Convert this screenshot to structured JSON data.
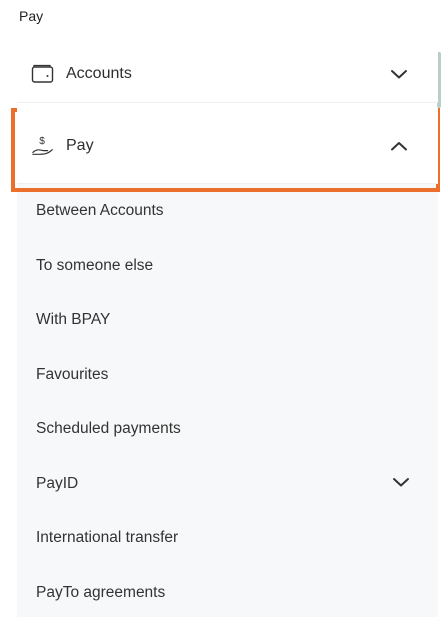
{
  "page_label": "Pay",
  "nav": {
    "accounts": {
      "label": "Accounts",
      "icon": "wallet-icon",
      "expanded": false
    },
    "pay": {
      "label": "Pay",
      "icon": "hand-dollar-icon",
      "expanded": true
    },
    "pay_items": [
      {
        "label": "Between Accounts"
      },
      {
        "label": "To someone else"
      },
      {
        "label": "With BPAY"
      },
      {
        "label": "Favourites"
      },
      {
        "label": "Scheduled payments"
      },
      {
        "label": "PayID",
        "has_children": true
      },
      {
        "label": "International transfer"
      },
      {
        "label": "PayTo agreements"
      }
    ]
  },
  "colors": {
    "highlight": "#ec6f2c",
    "submenu_bg": "#f7f8f9",
    "scroll_indicator": "#b8cfc8"
  }
}
